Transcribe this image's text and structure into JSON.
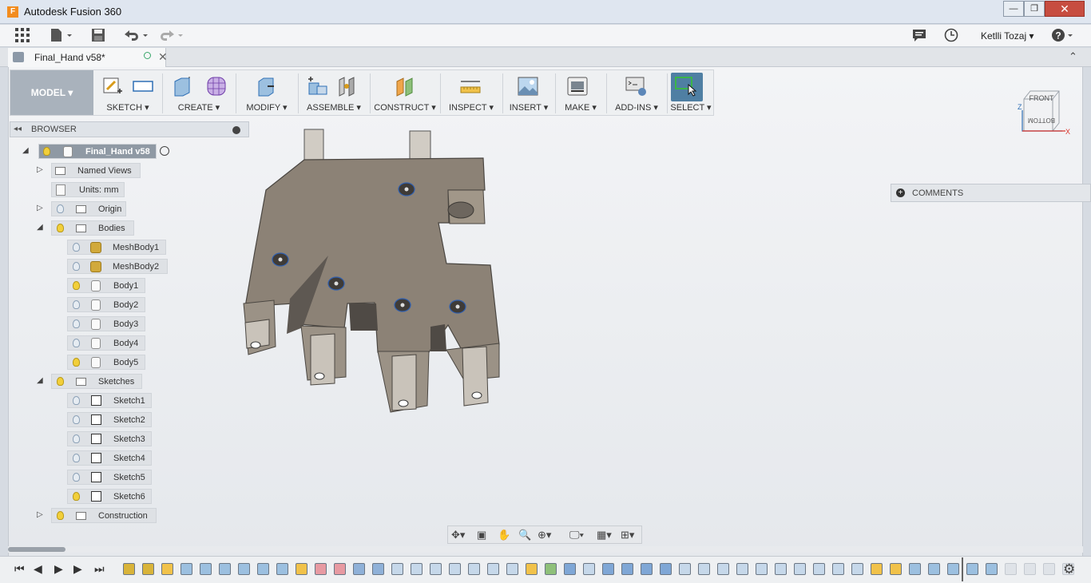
{
  "window": {
    "title": "Autodesk Fusion 360",
    "logo_letter": "F",
    "min_glyph": "—",
    "max_glyph": "❐",
    "close_glyph": "✕"
  },
  "appbar": {
    "user": "Ketlli Tozaj ▾",
    "icons": [
      "grid-icon",
      "file-icon",
      "save-icon",
      "undo-icon",
      "redo-icon",
      "comment-icon",
      "clock-icon",
      "help-icon"
    ]
  },
  "tab": {
    "label": "Final_Hand v58*",
    "close_glyph": "✕",
    "collapse_glyph": "⌃"
  },
  "ribbon": {
    "workspace": "MODEL ▾",
    "groups": [
      {
        "label": "SKETCH ▾"
      },
      {
        "label": "CREATE ▾"
      },
      {
        "label": "MODIFY ▾"
      },
      {
        "label": "ASSEMBLE ▾"
      },
      {
        "label": "CONSTRUCT ▾"
      },
      {
        "label": "INSPECT ▾"
      },
      {
        "label": "INSERT ▾"
      },
      {
        "label": "MAKE ▾"
      },
      {
        "label": "ADD-INS ▾"
      },
      {
        "label": "SELECT ▾"
      }
    ]
  },
  "browser": {
    "title": "BROWSER",
    "collapse_glyph": "◂◂",
    "items": [
      {
        "label": "Final_Hand v58",
        "icon": "document-icon"
      },
      {
        "label": "Named Views",
        "icon": "folder-icon"
      },
      {
        "label": "Units: mm",
        "icon": "document-icon"
      },
      {
        "label": "Origin",
        "icon": "folder-icon"
      },
      {
        "label": "Bodies",
        "icon": "folder-icon"
      },
      {
        "label": "MeshBody1",
        "icon": "mesh-body-icon"
      },
      {
        "label": "MeshBody2",
        "icon": "mesh-body-icon"
      },
      {
        "label": "Body1",
        "icon": "body-icon"
      },
      {
        "label": "Body2",
        "icon": "body-icon"
      },
      {
        "label": "Body3",
        "icon": "body-icon"
      },
      {
        "label": "Body4",
        "icon": "body-icon"
      },
      {
        "label": "Body5",
        "icon": "body-icon"
      },
      {
        "label": "Sketches",
        "icon": "folder-icon"
      },
      {
        "label": "Sketch1",
        "icon": "sketch-icon"
      },
      {
        "label": "Sketch2",
        "icon": "sketch-icon"
      },
      {
        "label": "Sketch3",
        "icon": "sketch-icon"
      },
      {
        "label": "Sketch4",
        "icon": "sketch-icon"
      },
      {
        "label": "Sketch5",
        "icon": "sketch-icon"
      },
      {
        "label": "Sketch6",
        "icon": "sketch-icon"
      },
      {
        "label": "Construction",
        "icon": "folder-icon"
      }
    ]
  },
  "comments": {
    "label": "COMMENTS",
    "plus_glyph": "+"
  },
  "viewcube": {
    "front": "FRONT",
    "bottom": "BOTTOM",
    "axis_z": "Z",
    "axis_x": "X"
  },
  "colors": {
    "model_face": "#8b8175",
    "model_shadow": "#5e5852",
    "select_active": "#4f7fa3",
    "timeline_yellow": "#d9b43a",
    "timeline_blue": "#5b86b8"
  }
}
